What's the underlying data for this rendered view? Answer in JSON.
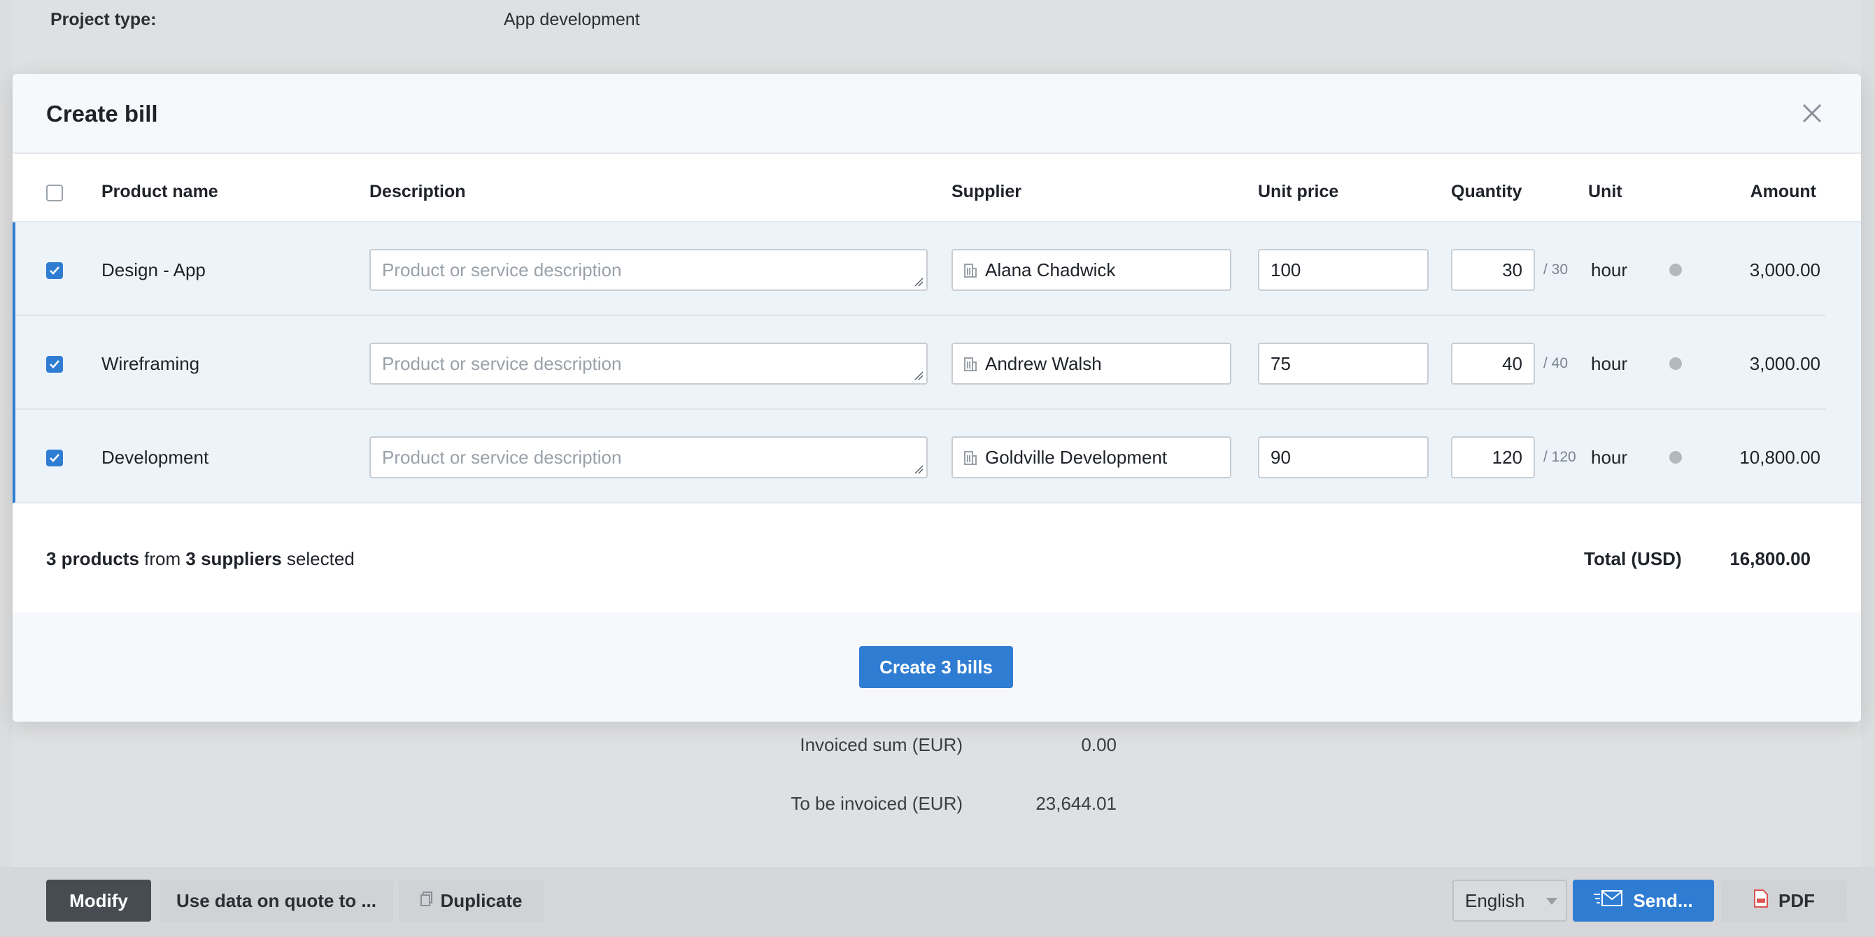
{
  "background": {
    "project_type_label": "Project type:",
    "project_type_value": "App development",
    "invoiced_sum_label": "Invoiced sum (EUR)",
    "invoiced_sum_value": "0.00",
    "to_be_invoiced_label": "To be invoiced (EUR)",
    "to_be_invoiced_value": "23,644.01"
  },
  "modal": {
    "title": "Create bill",
    "columns": {
      "product_name": "Product name",
      "description": "Description",
      "supplier": "Supplier",
      "unit_price": "Unit price",
      "quantity": "Quantity",
      "unit": "Unit",
      "amount": "Amount"
    },
    "rows": [
      {
        "checked": true,
        "product": "Design - App",
        "description_placeholder": "Product or service description",
        "supplier": "Alana Chadwick",
        "unit_price": "100",
        "quantity": "30",
        "quantity_of": "/ 30",
        "unit": "hour",
        "amount": "3,000.00"
      },
      {
        "checked": true,
        "product": "Wireframing",
        "description_placeholder": "Product or service description",
        "supplier": "Andrew Walsh",
        "unit_price": "75",
        "quantity": "40",
        "quantity_of": "/ 40",
        "unit": "hour",
        "amount": "3,000.00"
      },
      {
        "checked": true,
        "product": "Development",
        "description_placeholder": "Product or service description",
        "supplier": "Goldville Development",
        "unit_price": "90",
        "quantity": "120",
        "quantity_of": "/ 120",
        "unit": "hour",
        "amount": "10,800.00"
      }
    ],
    "summary": {
      "products_count": "3 products",
      "from_text": "from",
      "suppliers_count": "3 suppliers",
      "selected_text": "selected",
      "total_label": "Total (USD)",
      "total_value": "16,800.00"
    },
    "create_button": "Create 3 bills"
  },
  "toolbar": {
    "modify": "Modify",
    "use_data": "Use data on quote to ...",
    "duplicate": "Duplicate",
    "language": "English",
    "send": "Send...",
    "pdf": "PDF"
  },
  "colors": {
    "accent": "#2f7dd3",
    "row_selected_bg": "#edf4f9",
    "modal_header_bg": "#f6f8fb",
    "modify_button_bg": "#474b52",
    "pdf_icon": "#d9534f"
  },
  "icons": {
    "close": "close-icon",
    "supplier": "building-icon",
    "duplicate": "copy-icon",
    "send": "envelope-icon",
    "pdf": "pdf-file-icon",
    "checkbox": "checkmark-icon"
  }
}
